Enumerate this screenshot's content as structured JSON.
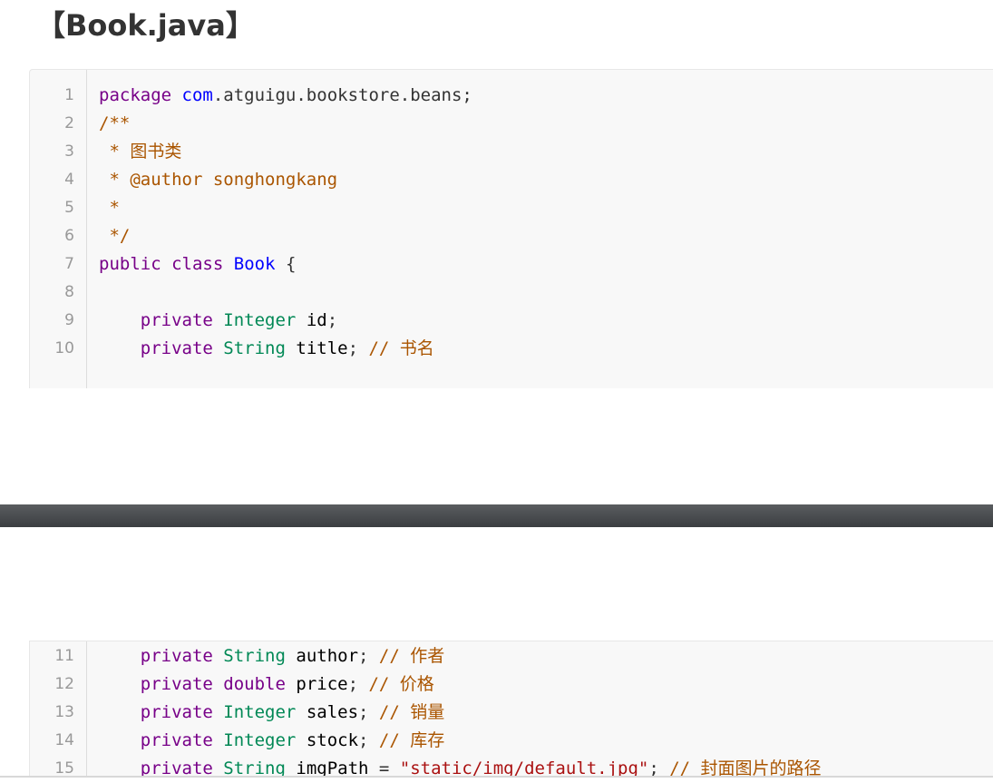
{
  "title": "【Book.java】",
  "block1": [
    {
      "n": "1",
      "tokens": [
        [
          "kw",
          "package"
        ],
        [
          "t",
          " "
        ],
        [
          "def",
          "com"
        ],
        [
          "t",
          ".atguigu.bookstore.beans;"
        ]
      ]
    },
    {
      "n": "2",
      "tokens": [
        [
          "cm",
          "/**"
        ]
      ]
    },
    {
      "n": "3",
      "tokens": [
        [
          "cm",
          " * 图书类"
        ]
      ]
    },
    {
      "n": "4",
      "tokens": [
        [
          "cm",
          " * @author songhongkang"
        ]
      ]
    },
    {
      "n": "5",
      "tokens": [
        [
          "cm",
          " *"
        ]
      ]
    },
    {
      "n": "6",
      "tokens": [
        [
          "cm",
          " */"
        ]
      ]
    },
    {
      "n": "7",
      "tokens": [
        [
          "kw",
          "public"
        ],
        [
          "t",
          " "
        ],
        [
          "kw",
          "class"
        ],
        [
          "t",
          " "
        ],
        [
          "def",
          "Book"
        ],
        [
          "t",
          " {"
        ]
      ]
    },
    {
      "n": "8",
      "tokens": []
    },
    {
      "n": "9",
      "tokens": [
        [
          "t",
          "    "
        ],
        [
          "kw",
          "private"
        ],
        [
          "t",
          " "
        ],
        [
          "type",
          "Integer"
        ],
        [
          "t",
          " "
        ],
        [
          "var",
          "id"
        ],
        [
          "t",
          ";"
        ]
      ]
    },
    {
      "n": "10",
      "tokens": [
        [
          "t",
          "    "
        ],
        [
          "kw",
          "private"
        ],
        [
          "t",
          " "
        ],
        [
          "type",
          "String"
        ],
        [
          "t",
          " "
        ],
        [
          "var",
          "title"
        ],
        [
          "t",
          "; "
        ],
        [
          "cm",
          "// 书名"
        ]
      ]
    }
  ],
  "block2": [
    {
      "n": "11",
      "tokens": [
        [
          "t",
          "    "
        ],
        [
          "kw",
          "private"
        ],
        [
          "t",
          " "
        ],
        [
          "type",
          "String"
        ],
        [
          "t",
          " "
        ],
        [
          "var",
          "author"
        ],
        [
          "t",
          "; "
        ],
        [
          "cm",
          "// 作者"
        ]
      ]
    },
    {
      "n": "12",
      "tokens": [
        [
          "t",
          "    "
        ],
        [
          "kw",
          "private"
        ],
        [
          "t",
          " "
        ],
        [
          "kw",
          "double"
        ],
        [
          "t",
          " "
        ],
        [
          "var",
          "price"
        ],
        [
          "t",
          "; "
        ],
        [
          "cm",
          "// 价格"
        ]
      ]
    },
    {
      "n": "13",
      "tokens": [
        [
          "t",
          "    "
        ],
        [
          "kw",
          "private"
        ],
        [
          "t",
          " "
        ],
        [
          "type",
          "Integer"
        ],
        [
          "t",
          " "
        ],
        [
          "var",
          "sales"
        ],
        [
          "t",
          "; "
        ],
        [
          "cm",
          "// 销量"
        ]
      ]
    },
    {
      "n": "14",
      "tokens": [
        [
          "t",
          "    "
        ],
        [
          "kw",
          "private"
        ],
        [
          "t",
          " "
        ],
        [
          "type",
          "Integer"
        ],
        [
          "t",
          " "
        ],
        [
          "var",
          "stock"
        ],
        [
          "t",
          "; "
        ],
        [
          "cm",
          "// 库存"
        ]
      ]
    },
    {
      "n": "15",
      "tokens": [
        [
          "t",
          "    "
        ],
        [
          "kw",
          "private"
        ],
        [
          "t",
          " "
        ],
        [
          "type",
          "String"
        ],
        [
          "t",
          " "
        ],
        [
          "var",
          "imgPath"
        ],
        [
          "t",
          " = "
        ],
        [
          "str",
          "\"static/img/default.jpg\""
        ],
        [
          "t",
          "; "
        ],
        [
          "cm",
          "// 封面图片的路径"
        ]
      ]
    }
  ]
}
